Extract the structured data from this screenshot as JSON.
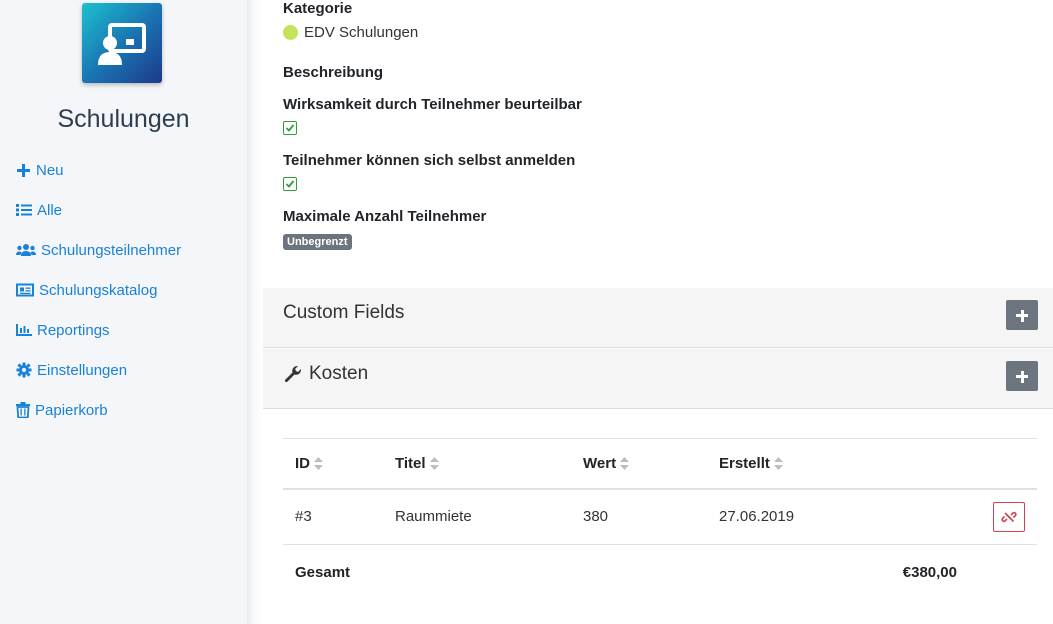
{
  "sidebar": {
    "app_title": "Schulungen",
    "nav": [
      {
        "label": "Neu",
        "icon": "plus-icon"
      },
      {
        "label": "Alle",
        "icon": "list-icon"
      },
      {
        "label": "Schulungsteilnehmer",
        "icon": "users-icon"
      },
      {
        "label": "Schulungskatalog",
        "icon": "newspaper-icon"
      },
      {
        "label": "Reportings",
        "icon": "chart-bar-icon"
      },
      {
        "label": "Einstellungen",
        "icon": "gear-icon"
      },
      {
        "label": "Papierkorb",
        "icon": "trash-icon"
      }
    ]
  },
  "details": {
    "kategorie_label": "Kategorie",
    "kategorie_value": "EDV Schulungen",
    "kategorie_color": "#c5e35a",
    "beschreibung_label": "Beschreibung",
    "wirksamkeit_label": "Wirksamkeit durch Teilnehmer beurteilbar",
    "wirksamkeit_checked": true,
    "selbst_anmelden_label": "Teilnehmer können sich selbst anmelden",
    "selbst_anmelden_checked": true,
    "max_teilnehmer_label": "Maximale Anzahl Teilnehmer",
    "max_teilnehmer_value": "Unbegrenzt"
  },
  "panels": {
    "custom_fields_title": "Custom Fields",
    "kosten_title": "Kosten"
  },
  "kosten_table": {
    "columns": [
      "ID",
      "Titel",
      "Wert",
      "Erstellt"
    ],
    "rows": [
      {
        "id": "#3",
        "titel": "Raummiete",
        "wert": "380",
        "erstellt": "27.06.2019"
      }
    ],
    "total_label": "Gesamt",
    "total_value": "€380,00"
  }
}
